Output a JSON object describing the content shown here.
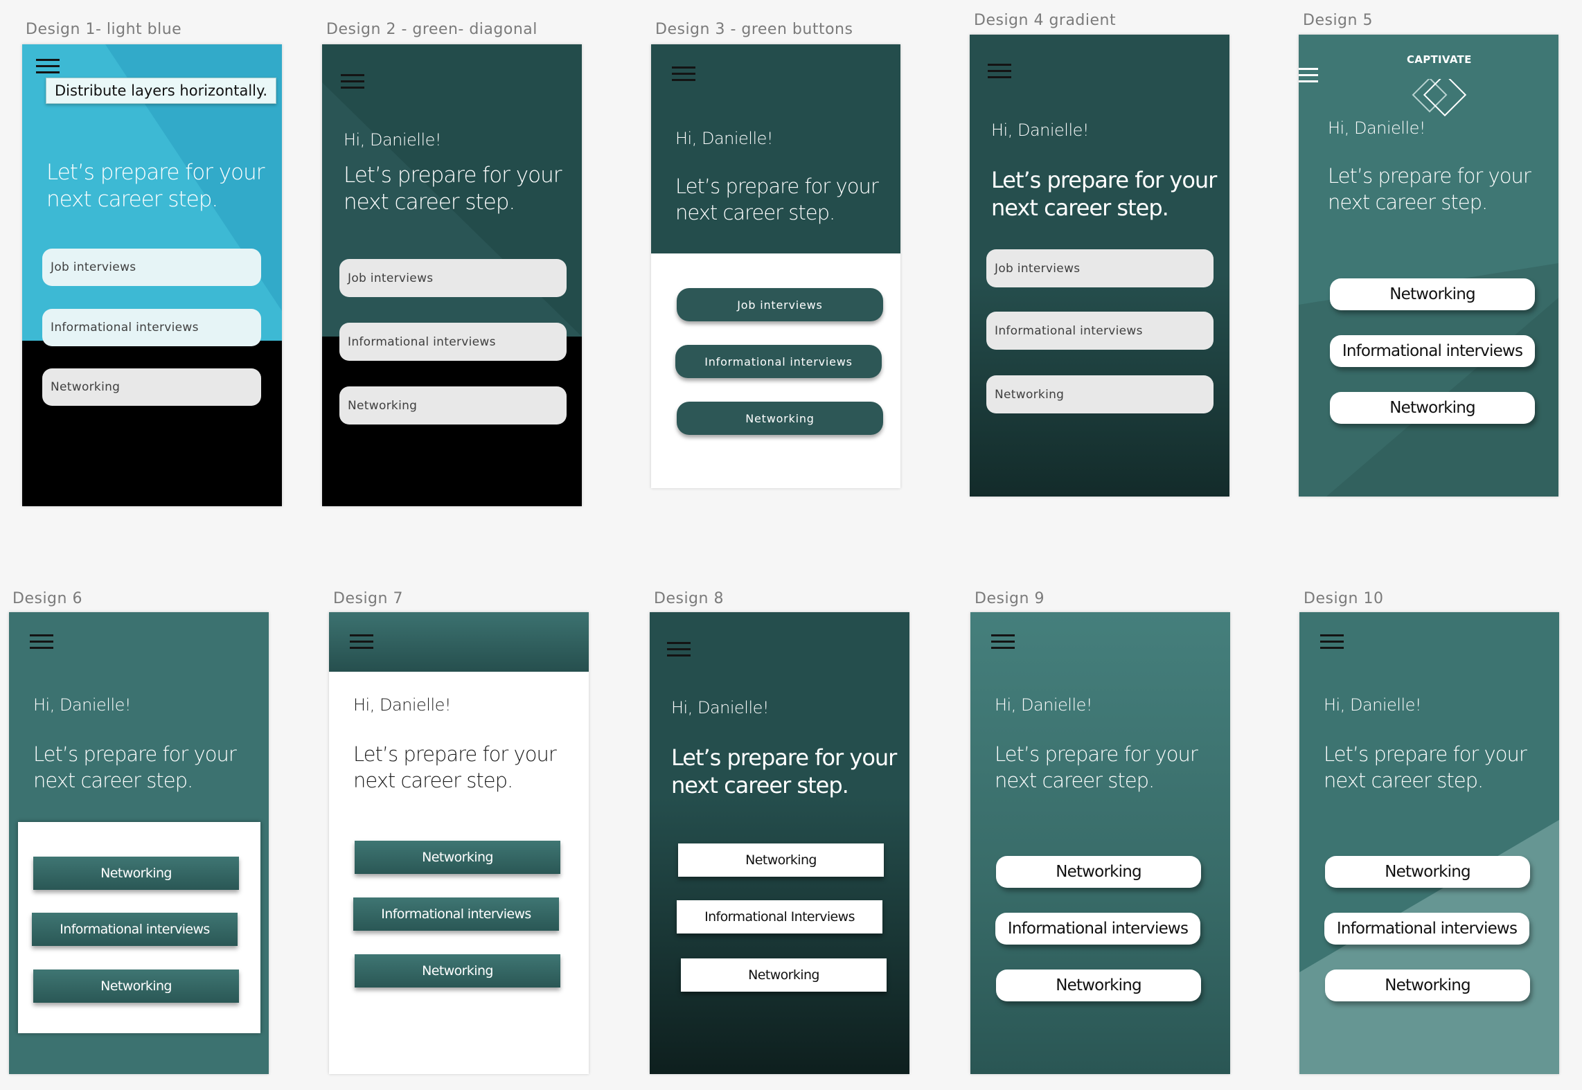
{
  "greeting": "Hi, Danielle!",
  "heading_line1": "Let’s prepare for your",
  "heading_line2": "next career step.",
  "tooltip": "Distribute layers horizontally.",
  "logo": "CAPTIVATE",
  "artboards": [
    {
      "label": "Design 1- light blue",
      "buttons": [
        "Job interviews",
        "Informational interviews",
        "Networking"
      ]
    },
    {
      "label": "Design 2 - green- diagonal",
      "buttons": [
        "Job interviews",
        "Informational interviews",
        "Networking"
      ]
    },
    {
      "label": "Design 3 - green buttons",
      "buttons": [
        "Job interviews",
        "Informational interviews",
        "Networking"
      ]
    },
    {
      "label": "Design 4 gradient",
      "buttons": [
        "Job interviews",
        "Informational interviews",
        "Networking"
      ]
    },
    {
      "label": "Design 5",
      "buttons": [
        "Networking",
        "Informational interviews",
        "Networking"
      ]
    },
    {
      "label": "Design 6",
      "buttons": [
        "Networking",
        "Informational interviews",
        "Networking"
      ]
    },
    {
      "label": "Design 7",
      "buttons": [
        "Networking",
        "Informational interviews",
        "Networking"
      ]
    },
    {
      "label": "Design 8",
      "buttons": [
        "Networking",
        "Informational Interviews",
        "Networking"
      ]
    },
    {
      "label": "Design 9",
      "buttons": [
        "Networking",
        "Informational interviews",
        "Networking"
      ]
    },
    {
      "label": "Design 10",
      "buttons": [
        "Networking",
        "Informational interviews",
        "Networking"
      ]
    }
  ],
  "colors": {
    "canvas": "#f6f6f6",
    "light_blue": "#3db8d3",
    "dark_green": "#244d4c",
    "teal": "#3e7572",
    "black": "#000000"
  }
}
